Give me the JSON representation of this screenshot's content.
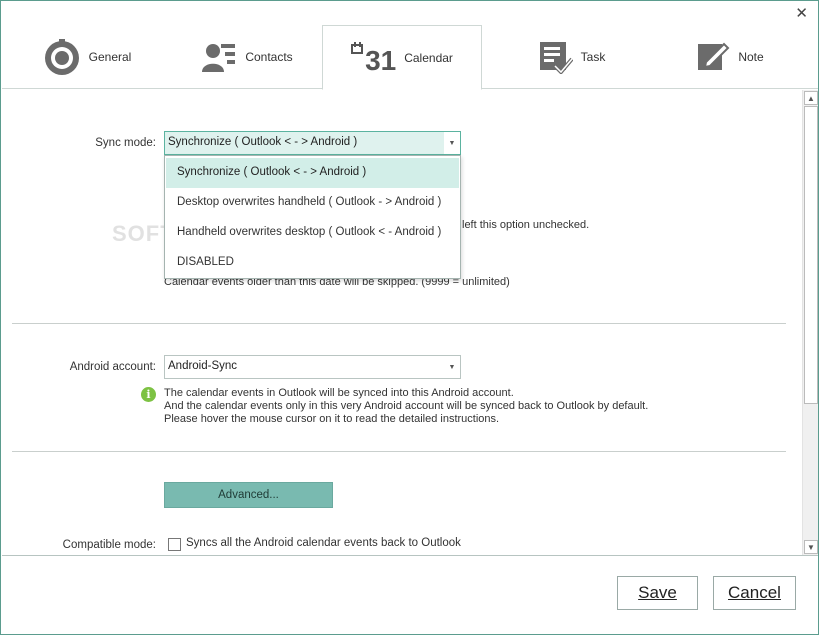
{
  "window": {
    "close_glyph": "✕"
  },
  "tabs": [
    {
      "label": "General",
      "icon": "gear-icon"
    },
    {
      "label": "Contacts",
      "icon": "contacts-icon"
    },
    {
      "label": "Calendar",
      "icon": "calendar-icon",
      "icon_text": "31",
      "active": true
    },
    {
      "label": "Task",
      "icon": "task-icon"
    },
    {
      "label": "Note",
      "icon": "note-icon"
    }
  ],
  "sync": {
    "label": "Sync mode:",
    "value": "Synchronize  ( Outlook < - > Android )",
    "options": [
      "Synchronize  ( Outlook < - > Android )",
      "Desktop overwrites handheld  ( Outlook - > Android )",
      "Handheld overwrites desktop  ( Outlook < - Android )",
      "DISABLED"
    ],
    "selected_index": 0,
    "hidden_note_tail": "left this option unchecked.",
    "hidden_note_days": "Calendar events older than this date will be skipped. (9999 = unlimited)"
  },
  "account": {
    "label": "Android account:",
    "value": "Android-Sync",
    "info_lines": [
      "The calendar events in Outlook will be synced into this Android account.",
      "And the calendar events only in this very Android account will be synced back to Outlook by default.",
      "Please hover the mouse cursor on it to read the detailed instructions."
    ]
  },
  "advanced": {
    "label": "Advanced..."
  },
  "compatible": {
    "label": "Compatible mode:",
    "checkbox_label": "Syncs all the Android calendar events back to Outlook",
    "checked": false
  },
  "footer": {
    "save_label": "Save",
    "cancel_label": "Cancel"
  },
  "colors": {
    "accent": "#79bab0",
    "selection": "#d2eee8",
    "info_green": "#7dc243",
    "border": "#5b9c8e"
  }
}
